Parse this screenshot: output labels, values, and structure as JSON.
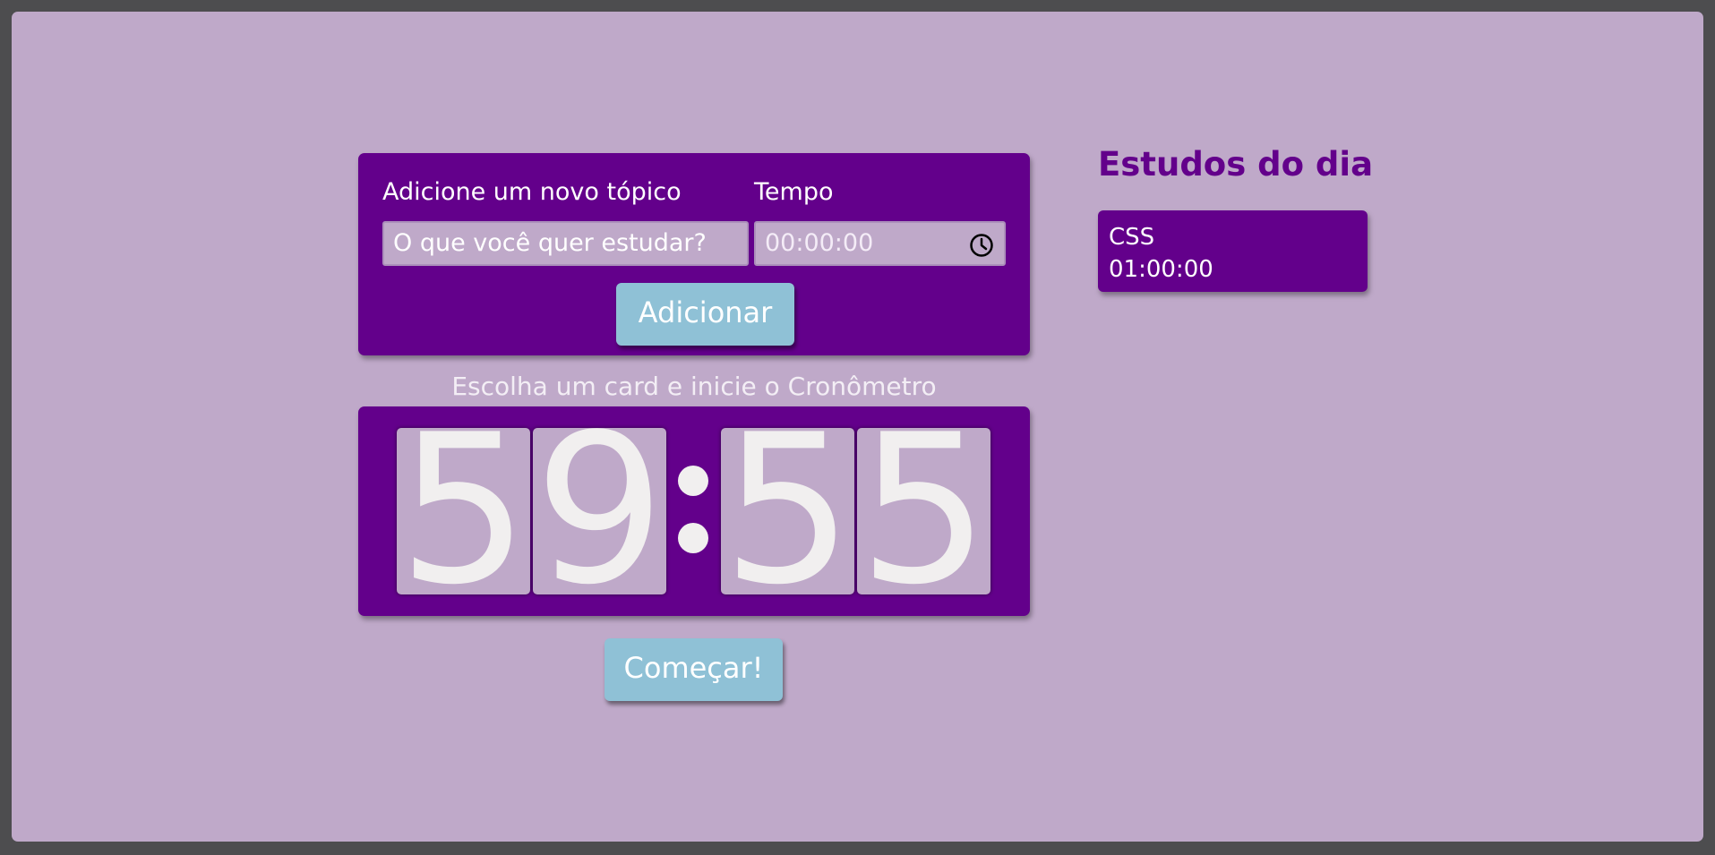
{
  "form": {
    "topic_label": "Adicione um novo tópico",
    "topic_placeholder": "O que você quer estudar?",
    "time_label": "Tempo",
    "time_value": "00:00:00",
    "time_icon": "clock-icon",
    "add_button": "Adicionar"
  },
  "stopwatch": {
    "caption": "Escolha um card e inicie o Cronômetro",
    "digits": [
      "5",
      "9",
      "5",
      "5"
    ],
    "start_button": "Começar!"
  },
  "sidebar": {
    "title": "Estudos do dia",
    "items": [
      {
        "name": "CSS",
        "time": "01:00:00"
      }
    ]
  },
  "colors": {
    "background": "#bfa9c9",
    "panel": "#63008b",
    "button": "#8fc1d6",
    "digit_text": "#f1efef",
    "frame": "#4d4d4f"
  }
}
